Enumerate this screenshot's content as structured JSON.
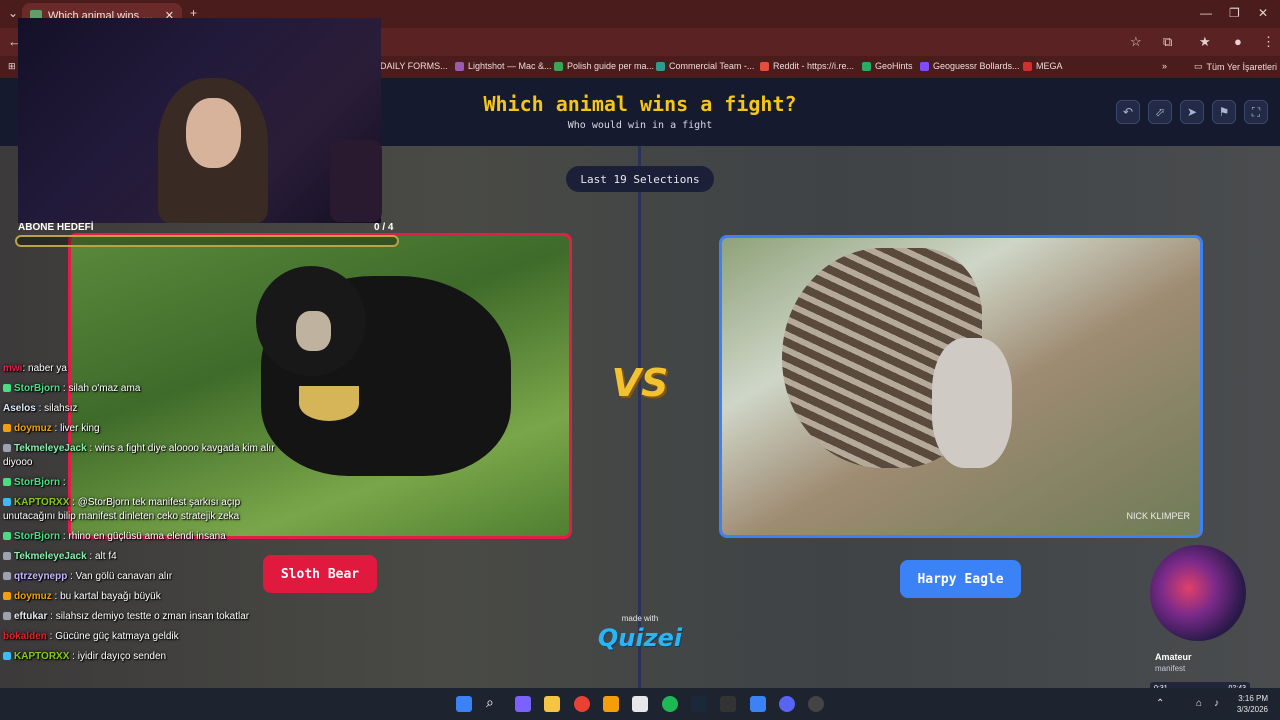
{
  "browser": {
    "tab_title": "Which animal wins a fight? - Ti",
    "bookmarks": [
      {
        "label": "DAILY FORMS...",
        "color": "#6b2a2a"
      },
      {
        "label": "Lightshot — Mac &...",
        "color": "#9b59b6"
      },
      {
        "label": "Polish guide per ma...",
        "color": "#34a853"
      },
      {
        "label": "Commercial Team -...",
        "color": "#2a9d8f"
      },
      {
        "label": "Reddit - https://i.re...",
        "color": "#e74c3c"
      },
      {
        "label": "GeoHints",
        "color": "#27ae60"
      },
      {
        "label": "Geoguessr Bollards...",
        "color": "#7c4dff"
      },
      {
        "label": "MEGA",
        "color": "#d32f2f"
      }
    ],
    "all_bookmarks": "Tüm Yer İşaretleri"
  },
  "game": {
    "title": "Which animal wins a fight?",
    "subtitle": "Who would win in a fight",
    "selections_pill": "Last 19 Selections",
    "vs": "VS",
    "left_choice": "Sloth Bear",
    "right_choice": "Harpy Eagle",
    "right_watermark": "NICK KLIMPER",
    "made_with": "made with",
    "brand": "Quizei"
  },
  "overlay": {
    "goal_label": "ABONE HEDEFİ",
    "goal_count": "0 / 4",
    "goal_progress": 0
  },
  "chat": [
    {
      "user": "mwi",
      "color": "#e11d48",
      "text": ": naber ya",
      "badge": ""
    },
    {
      "user": "StorBjorn",
      "color": "#4ade80",
      "text": " : silah o'maz ama",
      "badge": "#4ade80"
    },
    {
      "user": "Aselos",
      "color": "#dbeafe",
      "text": " : silahsız",
      "badge": ""
    },
    {
      "user": "doymuz",
      "color": "#f59e0b",
      "text": " : liver king",
      "badge": "#f59e0b"
    },
    {
      "user": "TekmeleyeJack",
      "color": "#86efac",
      "text": " : wins a fight diye aloooo kavgada kim alır diyooo",
      "badge": "#9ca3af"
    },
    {
      "user": "StorBjorn",
      "color": "#4ade80",
      "text": " :",
      "badge": "#4ade80"
    },
    {
      "user": "KAPTORXX",
      "color": "#84cc16",
      "text": " : @StorBjorn tek manifest şarkısı açıp unutacağını bilip manifest dinleten ceko stratejik zeka",
      "badge": "#38bdf8"
    },
    {
      "user": "StorBjorn",
      "color": "#4ade80",
      "text": " : rhino en güçlüsü ama elendi insana",
      "badge": "#4ade80"
    },
    {
      "user": "TekmeleyeJack",
      "color": "#86efac",
      "text": " : alt f4",
      "badge": "#9ca3af"
    },
    {
      "user": "qtrzeynepp",
      "color": "#c4b5fd",
      "text": " : Van gölü canavarı alır",
      "badge": "#9ca3af"
    },
    {
      "user": "doymuz",
      "color": "#f59e0b",
      "text": " : bu kartal bayağı büyük",
      "badge": "#f59e0b"
    },
    {
      "user": "eftukar",
      "color": "#e5e7eb",
      "text": " : silahsız demiyo testte o zman insan tokatlar",
      "badge": "#9ca3af"
    },
    {
      "user": "bokalden",
      "color": "#dc2626",
      "text": " : Gücüne güç katmaya geldik",
      "badge": ""
    },
    {
      "user": "KAPTORXX",
      "color": "#84cc16",
      "text": " : iyidir dayıço senden",
      "badge": "#38bdf8"
    }
  ],
  "now_playing": {
    "title": "Amateur",
    "artist": "manifest",
    "current": "0:31",
    "total": "02:43",
    "progress": 0.19
  },
  "taskbar": {
    "time": "3:16 PM",
    "date": "3/3/2026"
  }
}
